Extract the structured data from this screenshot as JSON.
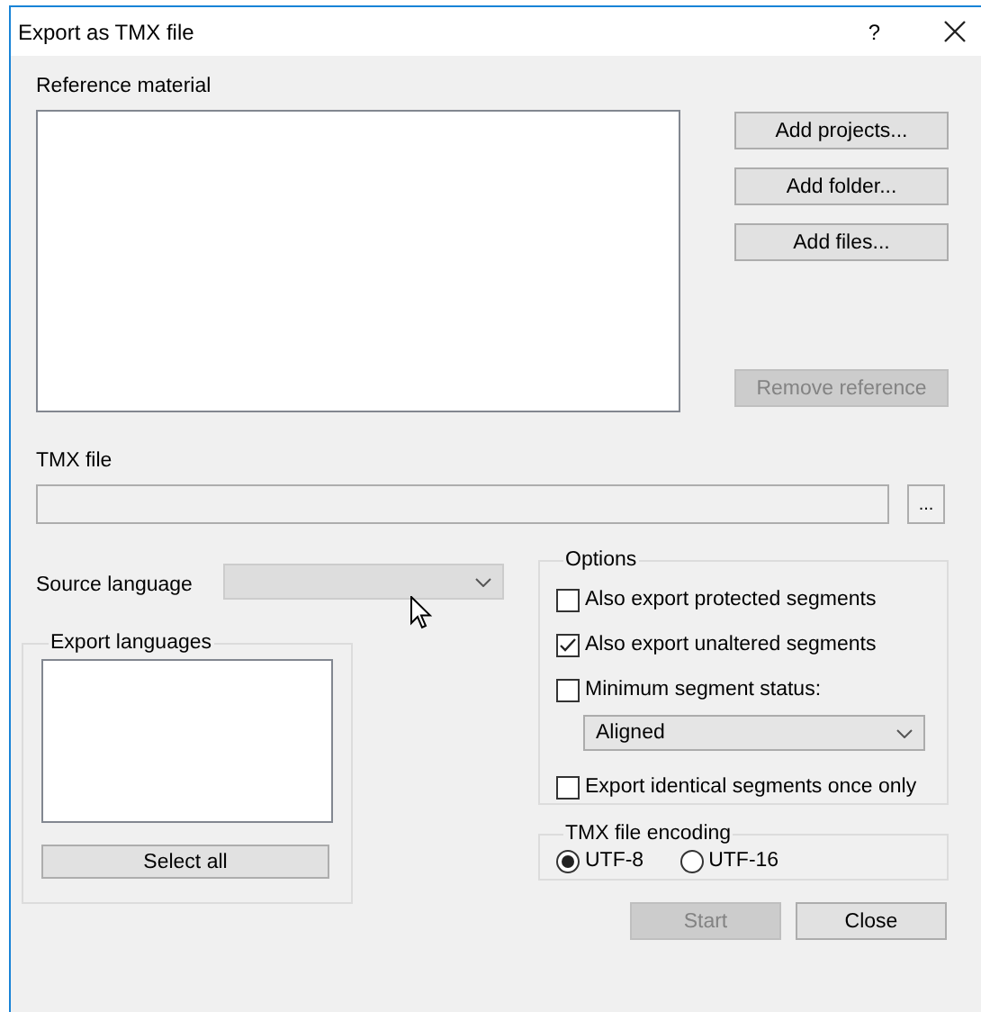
{
  "window": {
    "title": "Export as TMX file",
    "help": "?"
  },
  "reference": {
    "label": "Reference material",
    "buttons": [
      {
        "label": "Add projects...",
        "disabled": false
      },
      {
        "label": "Add folder...",
        "disabled": false
      },
      {
        "label": "Add files...",
        "disabled": false
      },
      {
        "label": "Remove reference",
        "disabled": true
      }
    ]
  },
  "tmx_file": {
    "label": "TMX file",
    "browse": "..."
  },
  "source_language": {
    "label": "Source language",
    "disabled": true
  },
  "export_languages": {
    "title": "Export languages",
    "button": "Select all"
  },
  "options": {
    "title": "Options",
    "items": [
      {
        "kind": "checkbox",
        "label": "Also export protected segments",
        "checked": false
      },
      {
        "kind": "checkbox",
        "label": "Also export unaltered segments",
        "checked": true
      },
      {
        "kind": "checkbox",
        "label": "Minimum segment status:",
        "checked": false
      },
      {
        "kind": "dropdown",
        "value": "Aligned"
      },
      {
        "kind": "checkbox",
        "label": "Export identical segments once only",
        "checked": false
      }
    ]
  },
  "encoding": {
    "title": "TMX file encoding",
    "options": [
      {
        "label": "UTF-8",
        "selected": true
      },
      {
        "label": "UTF-16",
        "selected": false
      }
    ]
  },
  "actions": [
    {
      "label": "Start",
      "disabled": true
    },
    {
      "label": "Close",
      "disabled": false
    }
  ]
}
